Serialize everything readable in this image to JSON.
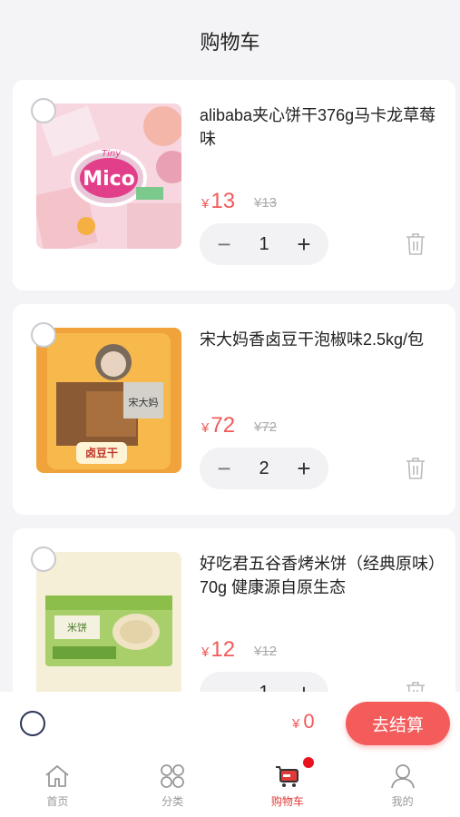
{
  "header": {
    "title": "购物车"
  },
  "colors": {
    "accent": "#f25a5a",
    "button": "#f45c5c",
    "active_tab": "#e03a3a",
    "badge": "#e8131d"
  },
  "cart": {
    "items": [
      {
        "title": "alibaba夹心饼干376g马卡龙草莓味",
        "currency": "¥",
        "price": "13",
        "original_price": "¥13",
        "quantity": "1",
        "image": "mico-cookie-package"
      },
      {
        "title": "宋大妈香卤豆干泡椒味2.5kg/包",
        "currency": "¥",
        "price": "72",
        "original_price": "¥72",
        "quantity": "2",
        "image": "tofu-snack-bag"
      },
      {
        "title": "好吃君五谷香烤米饼（经典原味）70g 健康源自原生态",
        "currency": "¥",
        "price": "12",
        "original_price": "¥12",
        "quantity": "1",
        "image": "rice-cracker-box"
      }
    ]
  },
  "checkout": {
    "currency": "¥",
    "total": "0",
    "pay_label": "去结算"
  },
  "tabbar": {
    "items": [
      {
        "label": "首页",
        "icon": "home-icon",
        "active": false
      },
      {
        "label": "分类",
        "icon": "category-icon",
        "active": false
      },
      {
        "label": "购物车",
        "icon": "cart-icon",
        "active": true,
        "badge": true
      },
      {
        "label": "我的",
        "icon": "user-icon",
        "active": false
      }
    ]
  }
}
